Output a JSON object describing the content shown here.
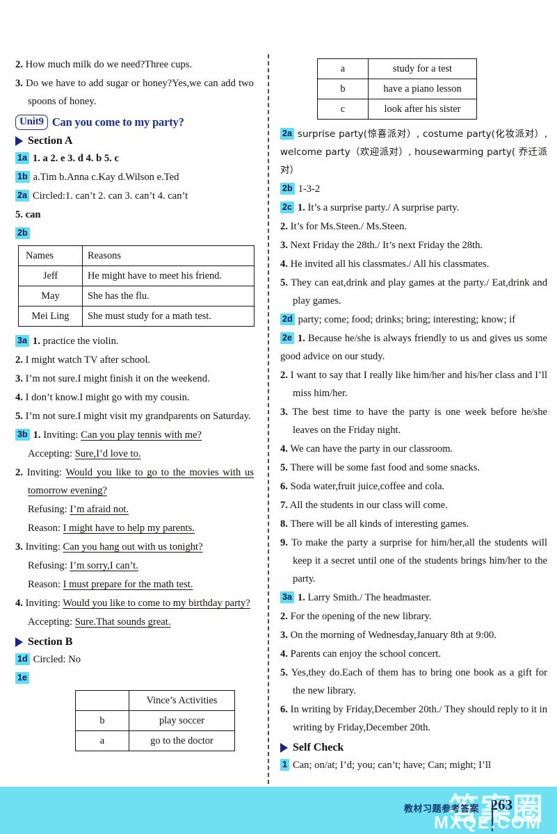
{
  "page": {
    "footer_caption": "教材习题参考答案",
    "page_number": "263",
    "watermark_cn": "答案圈",
    "watermark_en": "MXQE.COM"
  },
  "left": {
    "carryover": [
      {
        "num": "2.",
        "text": "How much milk do we need?Three cups."
      },
      {
        "num": "3.",
        "text": "Do we have to add sugar or honey?Yes,we can add two spoons of honey."
      }
    ],
    "unit": {
      "badge": "Unit9",
      "title": "Can you come to my party?"
    },
    "section_a": {
      "label": "Section A"
    },
    "ex_1a": {
      "id": "1a",
      "text": "1. a   2. e   3. d   4. b   5. c"
    },
    "ex_1b": {
      "id": "1b",
      "text": "a.Tim   b.Anna   c.Kay   d.Wilson   e.Ted"
    },
    "ex_2a": {
      "id": "2a",
      "text": "Circled:1. can’t   2. can   3. can’t   4. can’t",
      "line2": "5. can"
    },
    "ex_2b": {
      "id": "2b",
      "headers": [
        "Names",
        "Reasons"
      ],
      "rows": [
        [
          "Jeff",
          "He might have to meet his friend."
        ],
        [
          "May",
          "She has the flu."
        ],
        [
          "Mei Ling",
          "She must study for a math test."
        ]
      ]
    },
    "ex_3a": {
      "id": "3a",
      "items": [
        {
          "num": "1.",
          "text": "practice the violin."
        },
        {
          "num": "2.",
          "text": "I might watch TV after school."
        },
        {
          "num": "3.",
          "text": "I’m not sure.I might finish it on the weekend."
        },
        {
          "num": "4.",
          "text": "I don’t know.I might go with my cousin."
        },
        {
          "num": "5.",
          "text": "I’m not sure.I might visit my grandparents on Saturday."
        }
      ]
    },
    "ex_3b": {
      "id": "3b",
      "items": [
        {
          "num": "1.",
          "lines": [
            {
              "label": "Inviting: ",
              "answer": "Can you play tennis with me?"
            },
            {
              "label": "Accepting: ",
              "answer": "Sure,I’d love to."
            }
          ]
        },
        {
          "num": "2.",
          "lines": [
            {
              "label": "Inviting: ",
              "answer": "Would you like to go to the movies with us tomorrow evening?"
            },
            {
              "label": "Refusing: ",
              "answer": "I’m afraid not."
            },
            {
              "label": "Reason: ",
              "answer": "I might have to help my parents."
            }
          ]
        },
        {
          "num": "3.",
          "lines": [
            {
              "label": "Inviting: ",
              "answer": "Can you hang out with us tonight?"
            },
            {
              "label": "Refusing: ",
              "answer": "I’m sorry,I can’t."
            },
            {
              "label": "Reason: ",
              "answer": "I must prepare for the math test."
            }
          ]
        },
        {
          "num": "4.",
          "lines": [
            {
              "label": "Inviting: ",
              "answer": "Would you like to come to my birthday party?"
            },
            {
              "label": "Accepting: ",
              "answer": "Sure.That sounds great."
            }
          ]
        }
      ]
    },
    "section_b": {
      "label": "Section B"
    },
    "ex_1d": {
      "id": "1d",
      "text": "Circled: No"
    },
    "ex_1e": {
      "id": "1e",
      "headers": [
        "",
        "Vince’s Activities"
      ],
      "rows": [
        [
          "b",
          "play soccer"
        ],
        [
          "a",
          "go to the doctor"
        ]
      ]
    }
  },
  "right": {
    "top_table": {
      "rows": [
        [
          "a",
          "study for a test"
        ],
        [
          "b",
          "have a piano lesson"
        ],
        [
          "c",
          "look after his sister"
        ]
      ]
    },
    "ex_2a": {
      "id": "2a",
      "text": "surprise party(惊喜派对）, costume party(化妆派对）, welcome party（欢迎派对）, housewarming party( 乔迁派对）"
    },
    "ex_2b": {
      "id": "2b",
      "text": "1-3-2"
    },
    "ex_2c": {
      "id": "2c",
      "items": [
        {
          "num": "1.",
          "text": "It’s a surprise party./ A surprise party."
        },
        {
          "num": "2.",
          "text": "It’s for Ms.Steen./ Ms.Steen."
        },
        {
          "num": "3.",
          "text": "Next Friday the 28th./ It’s next Friday the 28th."
        },
        {
          "num": "4.",
          "text": "He invited all his classmates./ All his classmates."
        },
        {
          "num": "5.",
          "text": "They can eat,drink and play games at the party./ Eat,drink and play games."
        }
      ]
    },
    "ex_2d": {
      "id": "2d",
      "text": "party; come; food; drinks; bring; interesting; know; if"
    },
    "ex_2e": {
      "id": "2e",
      "items": [
        {
          "num": "1.",
          "text": "Because he/she is always friendly to us and gives us some good advice on our study."
        },
        {
          "num": "2.",
          "text": "I want to say that I really like him/her and his/her class and I’ll miss him/her."
        },
        {
          "num": "3.",
          "text": "The best time to have the party is one week before he/she leaves on the Friday night."
        },
        {
          "num": "4.",
          "text": "We can have the party in our classroom."
        },
        {
          "num": "5.",
          "text": "There will be some fast food and some snacks."
        },
        {
          "num": "6.",
          "text": "Soda water,fruit juice,coffee and cola."
        },
        {
          "num": "7.",
          "text": "All the students in our class will come."
        },
        {
          "num": "8.",
          "text": "There will be all kinds of interesting games."
        },
        {
          "num": "9.",
          "text": "To make the party a surprise for him/her,all the students will keep it a secret until one of the students brings him/her to the party."
        }
      ]
    },
    "ex_3a": {
      "id": "3a",
      "items": [
        {
          "num": "1.",
          "text": "Larry Smith./ The headmaster."
        },
        {
          "num": "2.",
          "text": "For the opening of the new library."
        },
        {
          "num": "3.",
          "text": "On the morning of Wednesday,January 8th at 9:00."
        },
        {
          "num": "4.",
          "text": "Parents can enjoy the school concert."
        },
        {
          "num": "5.",
          "text": "Yes,they do.Each of them has to bring one book as a gift for the new library."
        },
        {
          "num": "6.",
          "text": "In writing by Friday,December 20th./ They should reply to it in writing by Friday,December 20th."
        }
      ]
    },
    "self_check": {
      "label": "Self Check"
    },
    "ex_1": {
      "id": "1",
      "text": "Can; on/at; I’d; you; can’t; have; Can; might; I’ll"
    }
  }
}
